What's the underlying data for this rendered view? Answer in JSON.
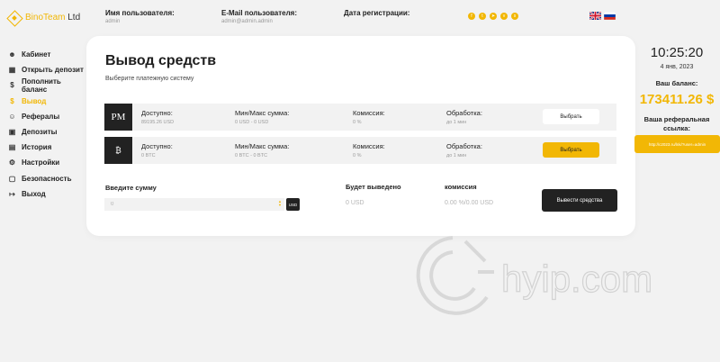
{
  "brand": {
    "part1": "BinoTeam",
    "part2": "Ltd"
  },
  "header": {
    "username_label": "Имя пользователя:",
    "username_value": "admin",
    "email_label": "E-Mail пользователя:",
    "email_value": "admin@admin.admin",
    "reg_label": "Дата регистрации:",
    "reg_value": ""
  },
  "socials": [
    "facebook",
    "twitter",
    "telegram",
    "vk",
    "skype"
  ],
  "languages": [
    "English",
    "Русский"
  ],
  "sidebar": {
    "items": [
      {
        "label": "Кабинет",
        "icon": "user-icon"
      },
      {
        "label": "Открыть депозит",
        "icon": "calendar-icon"
      },
      {
        "label": "Пополнить баланс",
        "icon": "dollar-icon"
      },
      {
        "label": "Вывод",
        "icon": "dollar-icon",
        "active": true
      },
      {
        "label": "Рефералы",
        "icon": "users-icon"
      },
      {
        "label": "Депозиты",
        "icon": "wallet-icon"
      },
      {
        "label": "История",
        "icon": "history-icon"
      },
      {
        "label": "Настройки",
        "icon": "gear-icon"
      },
      {
        "label": "Безопасность",
        "icon": "lock-icon"
      },
      {
        "label": "Выход",
        "icon": "logout-icon"
      }
    ]
  },
  "main": {
    "title": "Вывод средств",
    "subtitle": "Выберите платежную систему",
    "col_available": "Доступно:",
    "col_minmax": "Мин/Макс сумма:",
    "col_fee": "Комиссия:",
    "col_processing": "Обработка:",
    "payments": [
      {
        "icon_text": "PM",
        "available": "89195.26 USD",
        "minmax": "0 USD - 0 USD",
        "fee": "0 %",
        "processing": "до 1 мин",
        "button": "Выбрать",
        "selected": false
      },
      {
        "icon_text": "₿",
        "available": "0 BTC",
        "minmax": "0 BTC - 0 BTC",
        "fee": "0 %",
        "processing": "до 1 мин",
        "button": "Выбрать",
        "selected": true
      }
    ],
    "amount_label": "Введите сумму",
    "amount_value": "0",
    "currency": "USD",
    "will_withdraw_label": "Будет выведено",
    "will_withdraw_value": "0 USD",
    "commission_label": "комиссия",
    "commission_value": "0.00 %/0.00 USD",
    "withdraw_button": "Вывести средства"
  },
  "right": {
    "time": "10:25:20",
    "date": "4 янв, 2023",
    "balance_label": "Ваш баланс:",
    "balance": "173411.26 $",
    "ref_label": "Ваша реферальная ссылка:",
    "ref_link": "http://c2023.ru/lnk/?user=admin"
  },
  "watermark": "hyip.com",
  "colors": {
    "accent": "#f2b705",
    "dark": "#222222",
    "bg": "#f2f2f2"
  }
}
